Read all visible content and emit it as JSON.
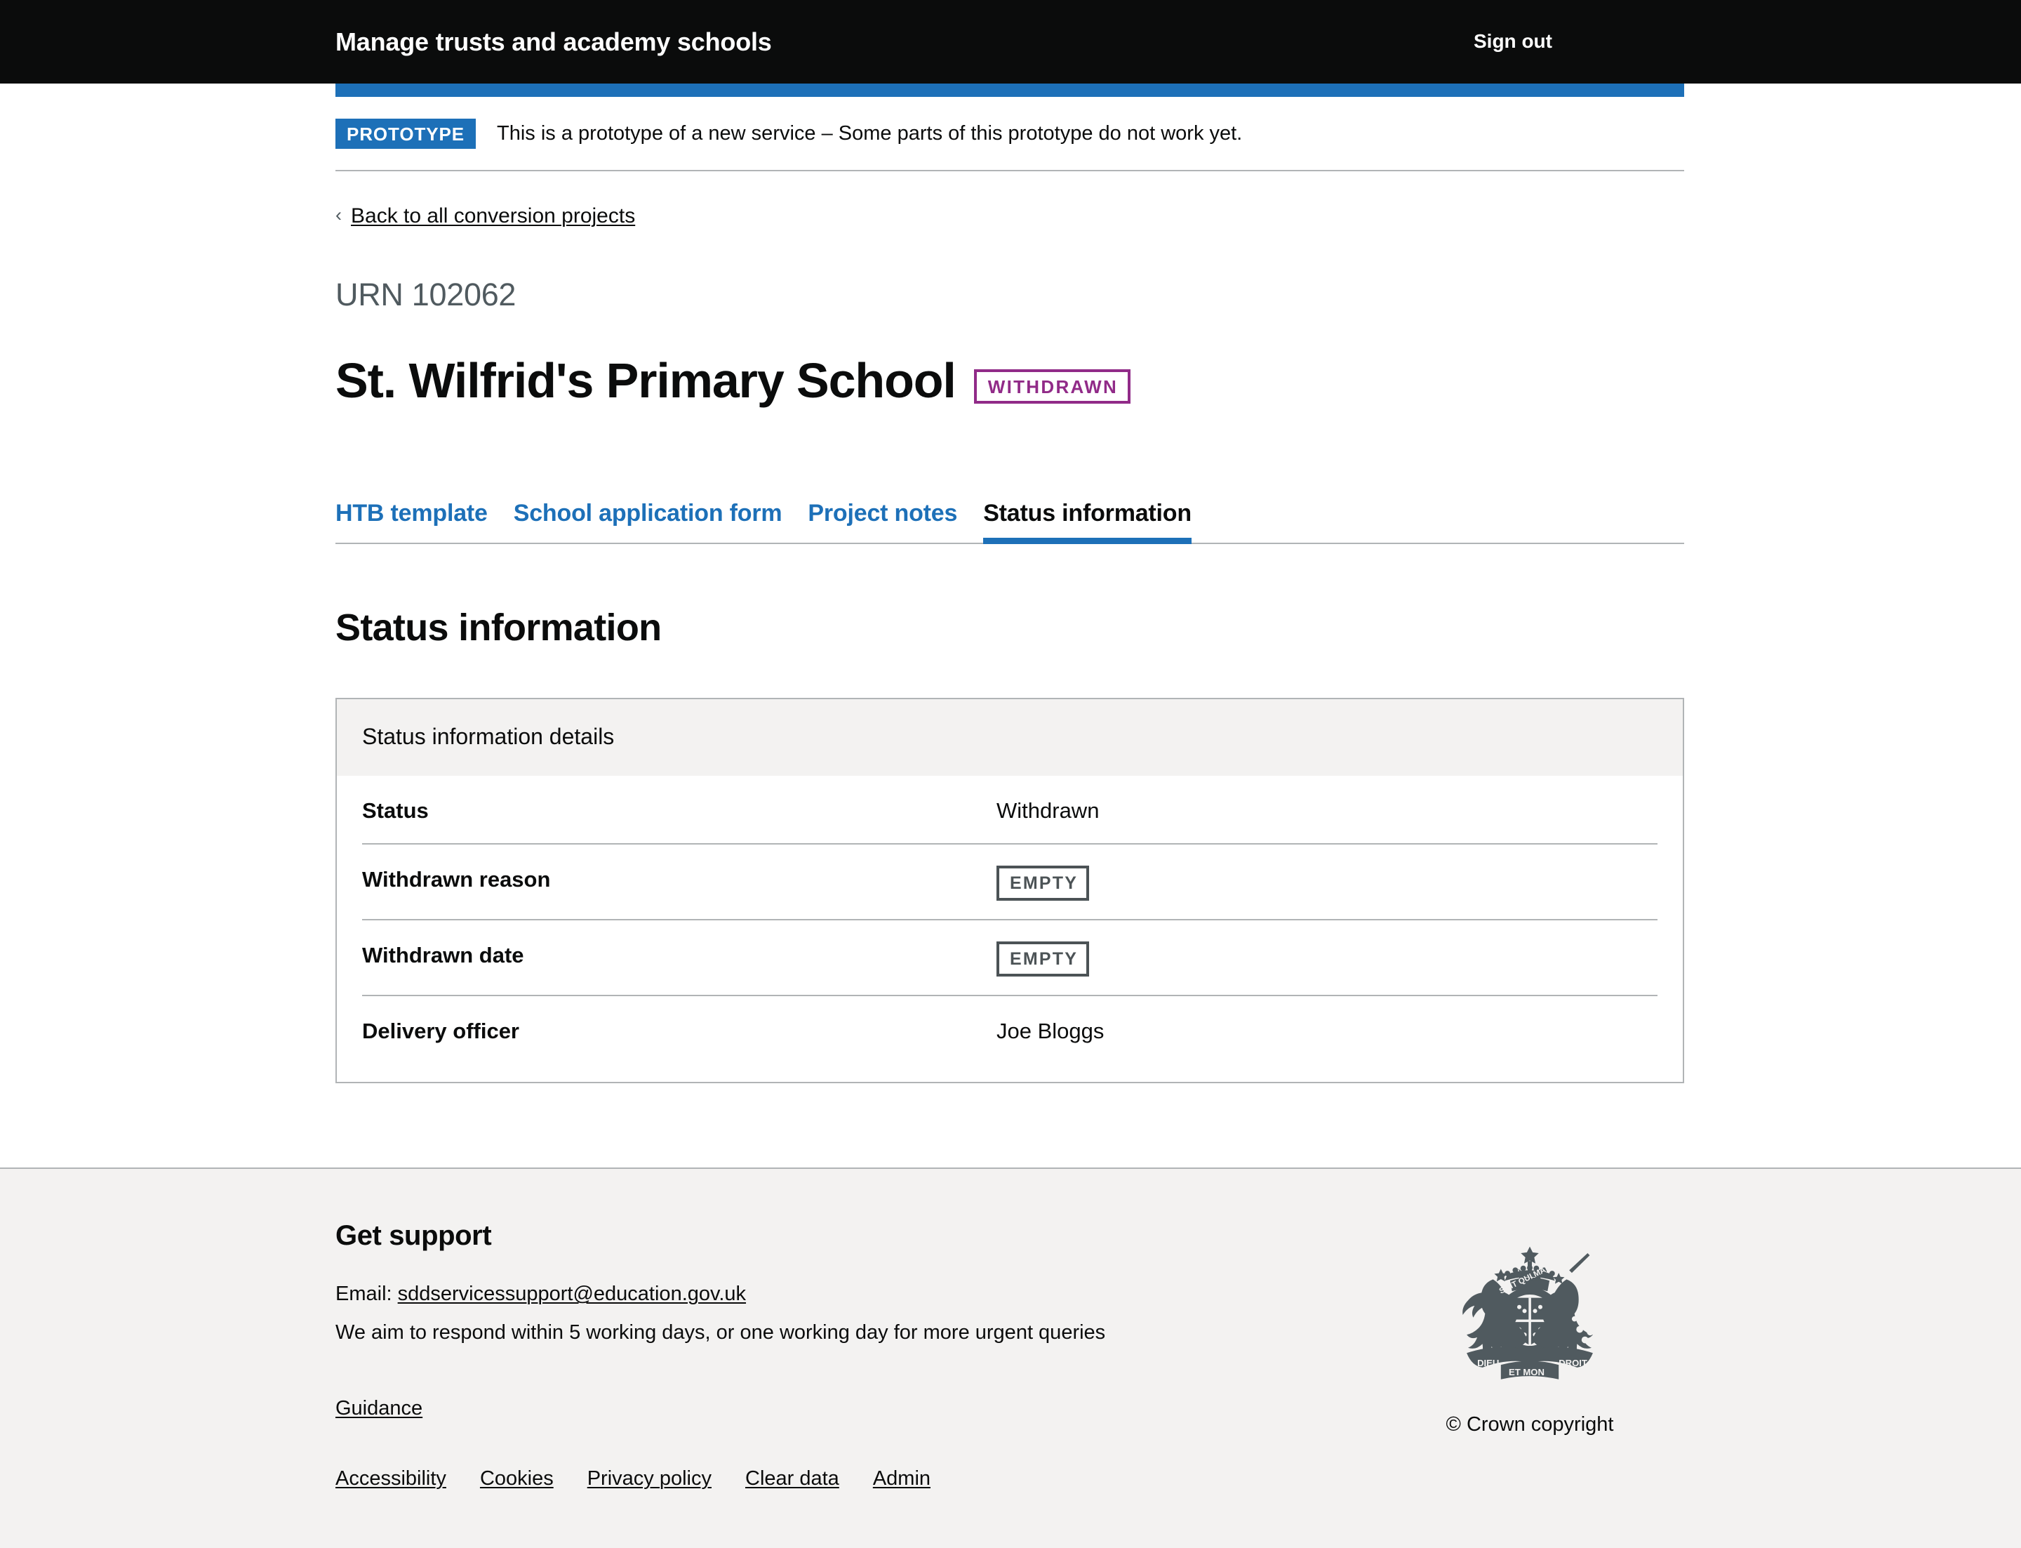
{
  "header": {
    "service_name": "Manage trusts and academy schools",
    "sign_out_label": "Sign out"
  },
  "phase_banner": {
    "tag": "PROTOTYPE",
    "text": "This is a prototype of a new service – Some parts of this prototype do not work yet."
  },
  "back_link": {
    "chevron": "‹",
    "label": "Back to all conversion projects"
  },
  "page": {
    "urn_caption": "URN 102062",
    "school_name": "St. Wilfrid's Primary School",
    "status_tag": "WITHDRAWN",
    "section_heading": "Status information"
  },
  "tabs": [
    {
      "label": "HTB template",
      "selected": false
    },
    {
      "label": "School application form",
      "selected": false
    },
    {
      "label": "Project notes",
      "selected": false
    },
    {
      "label": "Status information",
      "selected": true
    }
  ],
  "summary_card": {
    "title": "Status information details",
    "rows": [
      {
        "key": "Status",
        "value": "Withdrawn",
        "empty": false
      },
      {
        "key": "Withdrawn reason",
        "value": "EMPTY",
        "empty": true
      },
      {
        "key": "Withdrawn date",
        "value": "EMPTY",
        "empty": true
      },
      {
        "key": "Delivery officer",
        "value": "Joe Bloggs",
        "empty": false
      }
    ]
  },
  "footer": {
    "heading": "Get support",
    "email_prefix": "Email:",
    "email_address": "sddservicessupport@education.gov.uk",
    "response_text": "We aim to respond within 5 working days, or one working day for more urgent queries",
    "guidance_label": "Guidance",
    "meta_links": [
      "Accessibility",
      "Cookies",
      "Privacy policy",
      "Clear data",
      "Admin"
    ],
    "crown_caption": "© Crown copyright"
  },
  "colors": {
    "brand_blue": "#1d70b8",
    "header_black": "#0b0c0c",
    "tag_purple": "#912b88",
    "empty_grey": "#4c5356",
    "footer_bg": "#f3f2f1",
    "border_grey": "#b1b4b6"
  }
}
